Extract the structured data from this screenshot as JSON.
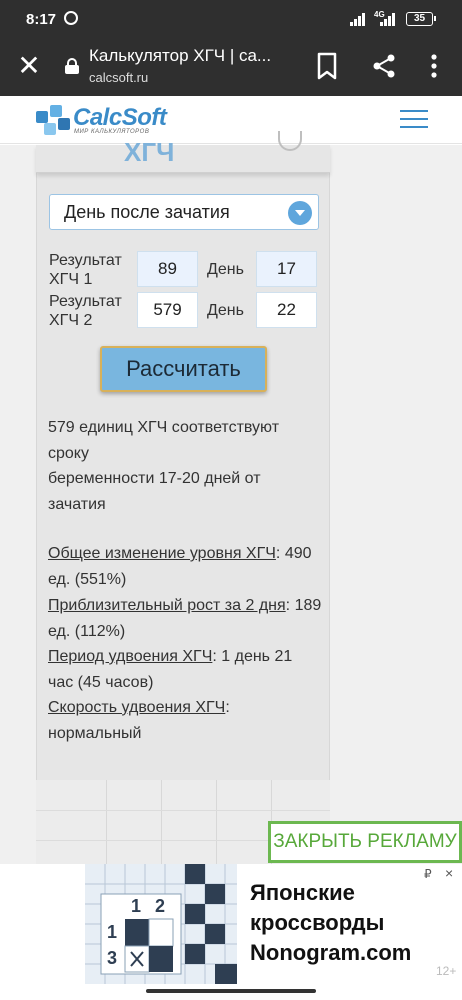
{
  "status_bar": {
    "time": "8:17",
    "network": "4G",
    "battery": "35"
  },
  "browser": {
    "title": "Калькулятор ХГЧ | са...",
    "url": "calcsoft.ru"
  },
  "site": {
    "logo_name": "CalcSoft",
    "logo_tagline": "МИР КАЛЬКУЛЯТОРОВ",
    "header_peek": "ХГЧ"
  },
  "form": {
    "mode_select": "День после зачатия",
    "rows": [
      {
        "label": "Результат ХГЧ 1",
        "value": "89",
        "day_label": "День",
        "day": "17"
      },
      {
        "label": "Результат ХГЧ 2",
        "value": "579",
        "day_label": "День",
        "day": "22"
      }
    ],
    "calculate_label": "Рассчитать"
  },
  "results": {
    "line1": "579 единиц ХГЧ соответствуют сроку",
    "line2": "беременности 17-20 дней от зачатия",
    "change_label": "Общее изменение уровня ХГЧ",
    "change_value": ": 490 ед. (551%)",
    "growth_label": "Приблизительный рост за 2 дня",
    "growth_value": ": 189 ед. (112%)",
    "doubling_label": "Период удвоения ХГЧ",
    "doubling_value": ": 1 день 21 час (45 часов)",
    "speed_label": "Скорость удвоения ХГЧ",
    "speed_value": ": нормальный"
  },
  "ad": {
    "close_label": "ЗАКРЫТЬ РЕКЛАМУ",
    "line1": "Японские",
    "line2": "кроссворды",
    "line3": "Nonogram.com",
    "badge": "₽",
    "close_x": "×",
    "age": "12+",
    "grid_numbers": [
      "1",
      "2",
      "1",
      "3"
    ]
  },
  "colors": {
    "accent": "#3a8bc8",
    "button": "#79b6df",
    "ad_green": "#6cb850"
  }
}
